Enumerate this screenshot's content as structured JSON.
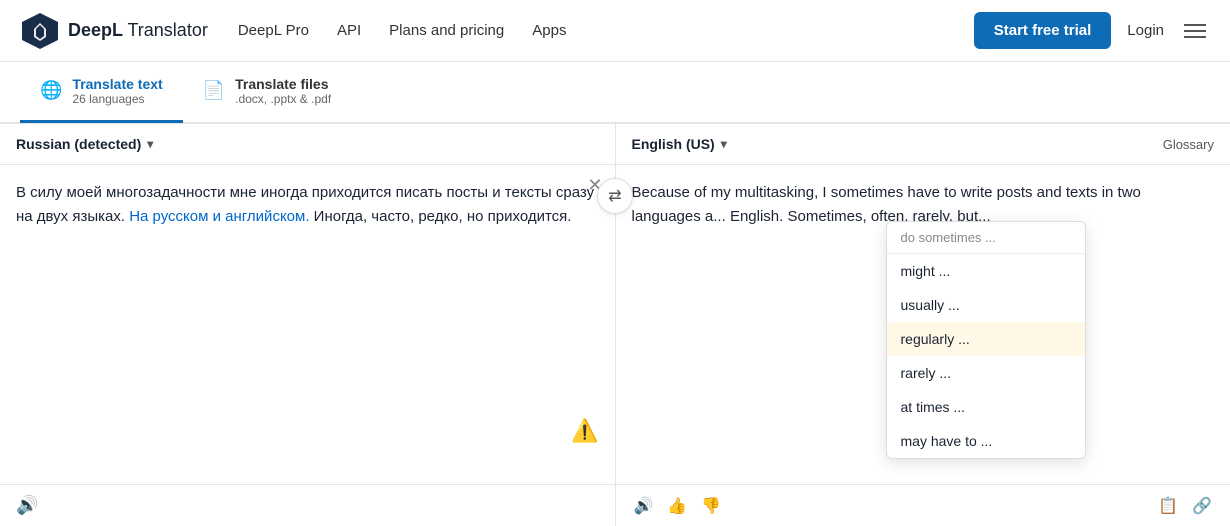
{
  "header": {
    "logo_brand": "DeepL",
    "logo_product": "Translator",
    "nav_items": [
      {
        "id": "deepl-pro",
        "label": "DeepL Pro"
      },
      {
        "id": "api",
        "label": "API"
      },
      {
        "id": "plans-pricing",
        "label": "Plans and pricing"
      },
      {
        "id": "apps",
        "label": "Apps"
      }
    ],
    "trial_btn": "Start free trial",
    "login_btn": "Login"
  },
  "tabs": [
    {
      "id": "translate-text",
      "icon": "🌐",
      "main": "Translate text",
      "sub": "26 languages",
      "active": true
    },
    {
      "id": "translate-files",
      "icon": "📄",
      "main": "Translate files",
      "sub": ".docx, .pptx & .pdf",
      "active": false
    }
  ],
  "source": {
    "language": "Russian (detected)",
    "text_plain": "В силу моей многозадачности мне иногда приходится писать посты и тексты сразу на двух языках.",
    "text_highlight": " На русском и английском.",
    "text_rest": " Иногда, часто, редко, но приходится.",
    "footer_speaker": "🔊"
  },
  "target": {
    "language": "English (US)",
    "glossary_label": "Glossary",
    "text": "Because of my multitasking, I sometimes have to write posts and texts in two languages a",
    "text2": "English.",
    "text3": "Sometimes, often, rarely, but",
    "footer_speaker": "🔊",
    "footer_thumbup": "👍",
    "footer_thumbdown": "👎",
    "footer_copy": "📋",
    "footer_share": "🔗"
  },
  "alternatives": {
    "header": "do sometimes ...",
    "items": [
      {
        "id": "might",
        "label": "might ...",
        "selected": false
      },
      {
        "id": "usually",
        "label": "usually ...",
        "selected": false
      },
      {
        "id": "regularly",
        "label": "regularly ...",
        "selected": true
      },
      {
        "id": "rarely",
        "label": "rarely ...",
        "selected": false
      },
      {
        "id": "at-times",
        "label": "at times ...",
        "selected": false
      },
      {
        "id": "may-have-to",
        "label": "may have to ...",
        "selected": false
      }
    ]
  },
  "icons": {
    "swap": "⇄",
    "clear": "✕",
    "error": "⚠",
    "chevron_down": "▾"
  }
}
